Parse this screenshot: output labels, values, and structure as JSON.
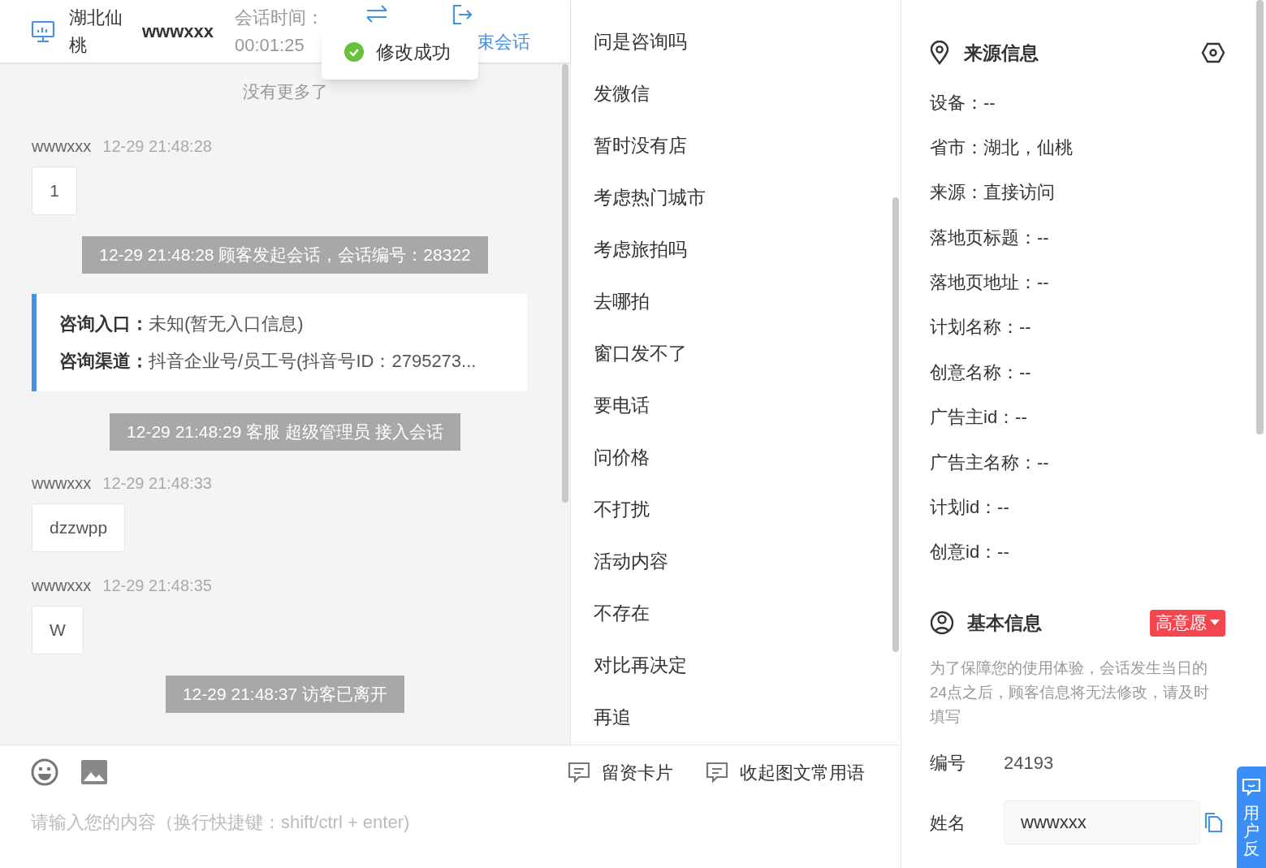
{
  "header": {
    "location": "湖北仙桃",
    "visitor": "wwwxxx",
    "duration_label": "会话时间：",
    "duration": "00:01:25",
    "end_button": "束会话"
  },
  "toast": {
    "text": "修改成功"
  },
  "chat": [
    {
      "kind": "notice",
      "text": "没有更多了"
    },
    {
      "kind": "message",
      "sender": "wwwxxx",
      "time": "12-29 21:48:28",
      "text": "1"
    },
    {
      "kind": "system",
      "text": "12-29 21:48:28 顾客发起会话，会话编号：28322"
    },
    {
      "kind": "card",
      "lines": [
        {
          "label": "咨询入口：",
          "value": "未知(暂无入口信息)"
        },
        {
          "label": "咨询渠道：",
          "value": "抖音企业号/员工号(抖音号ID：2795273..."
        }
      ]
    },
    {
      "kind": "system",
      "text": "12-29 21:48:29 客服 超级管理员 接入会话"
    },
    {
      "kind": "message",
      "sender": "wwwxxx",
      "time": "12-29 21:48:33",
      "text": "dzzwpp"
    },
    {
      "kind": "message",
      "sender": "wwwxxx",
      "time": "12-29 21:48:35",
      "text": "W"
    },
    {
      "kind": "system",
      "text": "12-29 21:48:37 访客已离开"
    }
  ],
  "composer": {
    "buttons": [
      "留资卡片",
      "收起图文常用语"
    ],
    "placeholder": "请输入您的内容（换行快捷键：shift/ctrl + enter)"
  },
  "quick_replies": [
    "问是咨询吗",
    "发微信",
    "暂时没有店",
    "考虑热门城市",
    "考虑旅拍吗",
    "去哪拍",
    "窗口发不了",
    "要电话",
    "问价格",
    "不打扰",
    "活动内容",
    "不存在",
    "对比再决定",
    "再追"
  ],
  "source_info": {
    "title": "来源信息",
    "fields": [
      "设备：--",
      "省市：湖北，仙桃",
      "来源：直接访问",
      "落地页标题：--",
      "落地页地址：--",
      "计划名称：--",
      "创意名称：--",
      "广告主id：--",
      "广告主名称：--",
      "计划id：--",
      "创意id：--"
    ]
  },
  "basic_info": {
    "title": "基本信息",
    "intent_tag": "高意愿",
    "note": "为了保障您的使用体验，会话发生当日的24点之后，顾客信息将无法修改，请及时填写",
    "id_label": "编号",
    "id_value": "24193",
    "name_label": "姓名",
    "name_value": "wwwxxx"
  },
  "feedback_tab": {
    "text": "用户反"
  }
}
